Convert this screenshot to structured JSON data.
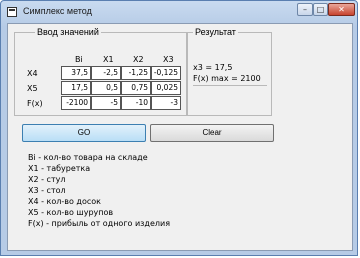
{
  "window": {
    "title": "Симплекс метод",
    "min_label": "–",
    "max_label": "□",
    "close_label": "✕"
  },
  "input_group": {
    "label": "Ввод значений",
    "columns": [
      "Bi",
      "X1",
      "X2",
      "X3"
    ],
    "rows": [
      {
        "label": "X4",
        "values": [
          "37,5",
          "-2,5",
          "-1,25",
          "-0,125"
        ]
      },
      {
        "label": "X5",
        "values": [
          "17,5",
          "0,5",
          "0,75",
          "0,025"
        ]
      },
      {
        "label": "F(x)",
        "values": [
          "-2100",
          "-5",
          "-10",
          "-3"
        ]
      }
    ]
  },
  "result_group": {
    "label": "Результат",
    "lines": [
      "x3 = 17,5",
      "F(x) max = 2100"
    ]
  },
  "buttons": {
    "go_label": "GO",
    "clear_label": "Clear"
  },
  "legend": [
    "Bi - кол-во товара на складе",
    "X1 - табуретка",
    "X2 - стул",
    "X3 - стол",
    "X4 - кол-во досок",
    "X5 - кол-во шурупов",
    "F(x) - прибыль от одного изделия"
  ]
}
